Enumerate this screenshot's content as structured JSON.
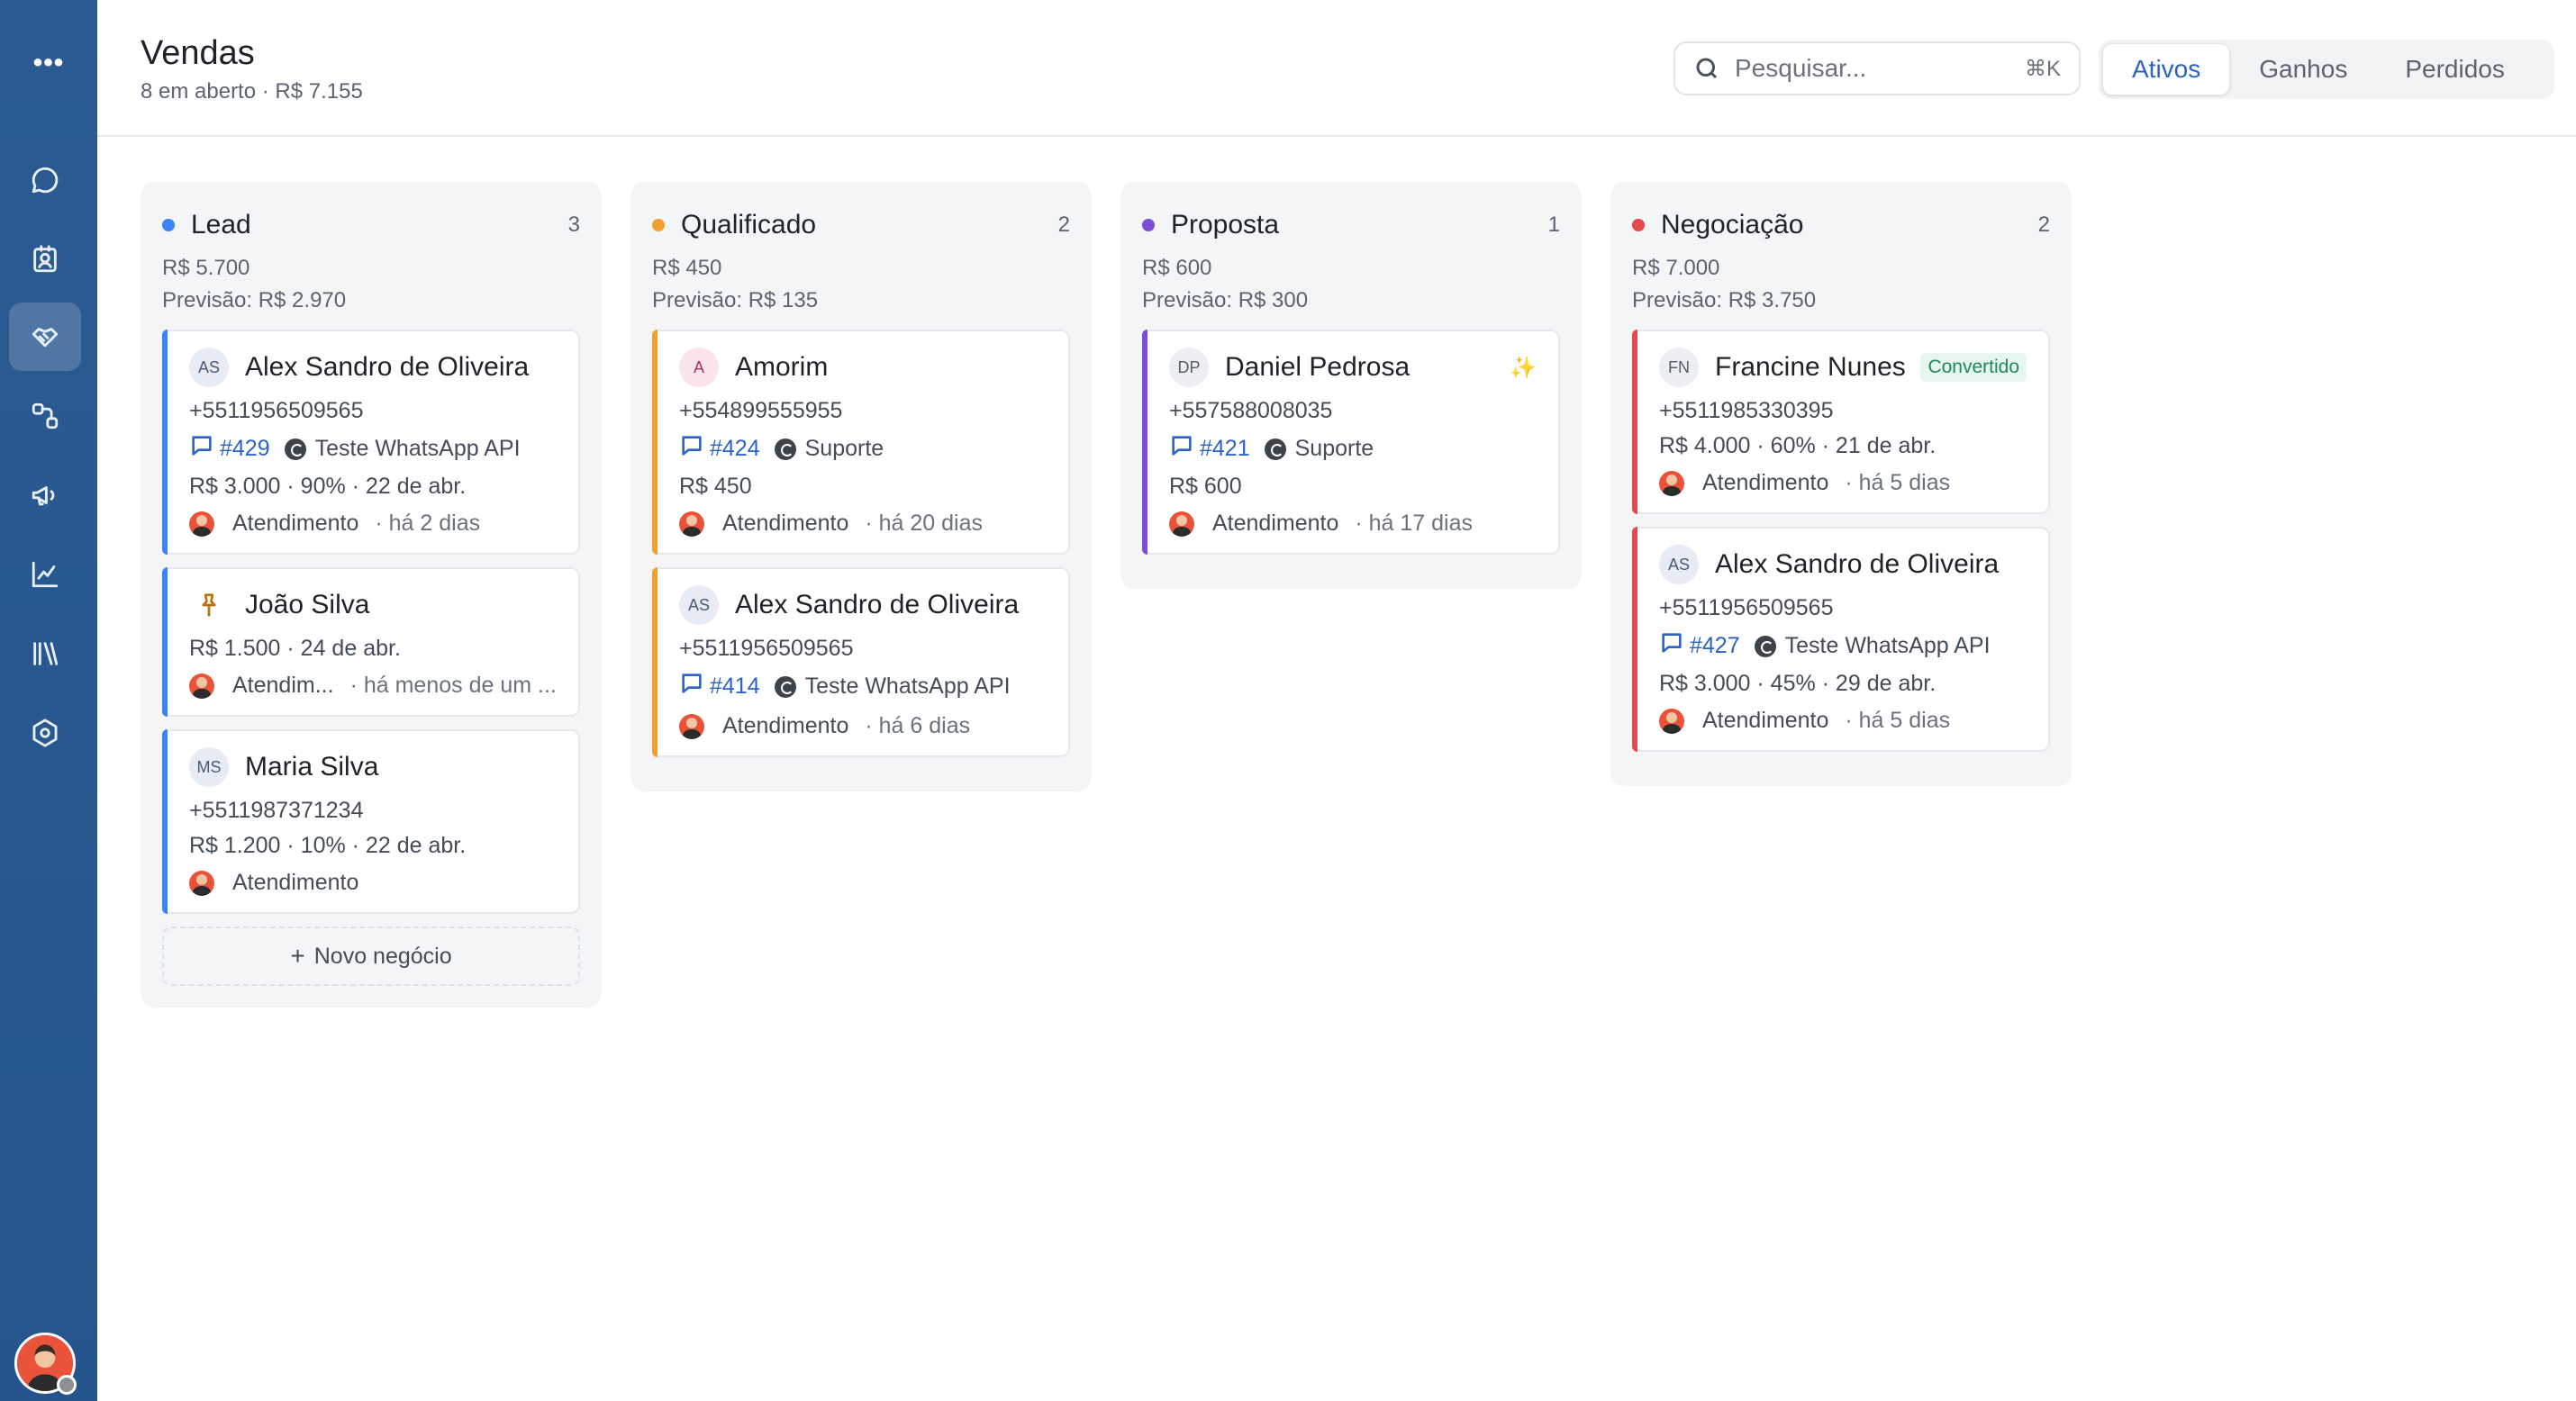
{
  "header": {
    "title": "Vendas",
    "subtitle": "8 em aberto · R$ 7.155",
    "search_placeholder": "Pesquisar...",
    "search_shortcut": "⌘K",
    "tabs": [
      "Ativos",
      "Ganhos",
      "Perdidos"
    ],
    "active_tab": "Ativos"
  },
  "sidebar": {
    "items": [
      "menu-icon",
      "conversations-icon",
      "contacts-icon",
      "deals-icon",
      "automations-icon",
      "campaigns-icon",
      "reports-icon",
      "library-icon",
      "settings-icon"
    ],
    "active": "deals-icon"
  },
  "colors": {
    "lead": "#3b82f6",
    "qualificado": "#f0a030",
    "proposta": "#7c4dd8",
    "negociacao": "#e5484d",
    "accent": "#2c62c5"
  },
  "columns": [
    {
      "title": "Lead",
      "count": "3",
      "total": "R$ 5.700",
      "forecast": "Previsão: R$ 2.970",
      "cards": [
        {
          "initials": "AS",
          "name": "Alex Sandro de Oliveira",
          "phone": "+5511956509565",
          "conv": "#429",
          "inbox": "Teste WhatsApp API",
          "value": "R$ 3.000 · 90% · 22 de abr.",
          "agent": "Atendimento",
          "time": "· há 2 dias"
        },
        {
          "name": "João Silva",
          "value": "R$ 1.500 · 24 de abr.",
          "agent": "Atendim...",
          "time": "· há menos de um ..."
        },
        {
          "initials": "MS",
          "name": "Maria Silva",
          "phone": "+5511987371234",
          "value": "R$ 1.200 · 10% · 22 de abr.",
          "agent": "Atendimento"
        }
      ],
      "new_deal": "Novo negócio"
    },
    {
      "title": "Qualificado",
      "count": "2",
      "total": "R$ 450",
      "forecast": "Previsão: R$ 135",
      "cards": [
        {
          "initials": "A",
          "name": "Amorim",
          "phone": "+554899555955",
          "conv": "#424",
          "inbox": "Suporte",
          "value": "R$ 450",
          "agent": "Atendimento",
          "time": "· há 20 dias"
        },
        {
          "initials": "AS",
          "name": "Alex Sandro de Oliveira",
          "phone": "+5511956509565",
          "conv": "#414",
          "inbox": "Teste WhatsApp API",
          "agent": "Atendimento",
          "time": "· há 6 dias"
        }
      ]
    },
    {
      "title": "Proposta",
      "count": "1",
      "total": "R$ 600",
      "forecast": "Previsão: R$ 300",
      "cards": [
        {
          "initials": "DP",
          "name": "Daniel Pedrosa",
          "phone": "+557588008035",
          "conv": "#421",
          "inbox": "Suporte",
          "value": "R$ 600",
          "agent": "Atendimento",
          "time": "· há 17 dias"
        }
      ]
    },
    {
      "title": "Negociação",
      "count": "2",
      "total": "R$ 7.000",
      "forecast": "Previsão: R$ 3.750",
      "cards": [
        {
          "initials": "FN",
          "name": "Francine Nunes",
          "badge": "Convertido",
          "phone": "+5511985330395",
          "value": "R$ 4.000 · 60% · 21 de abr.",
          "agent": "Atendimento",
          "time": "· há 5 dias"
        },
        {
          "initials": "AS",
          "name": "Alex Sandro de Oliveira",
          "phone": "+5511956509565",
          "conv": "#427",
          "inbox": "Teste WhatsApp API",
          "value": "R$ 3.000 · 45% · 29 de abr.",
          "agent": "Atendimento",
          "time": "· há 5 dias"
        }
      ]
    }
  ]
}
